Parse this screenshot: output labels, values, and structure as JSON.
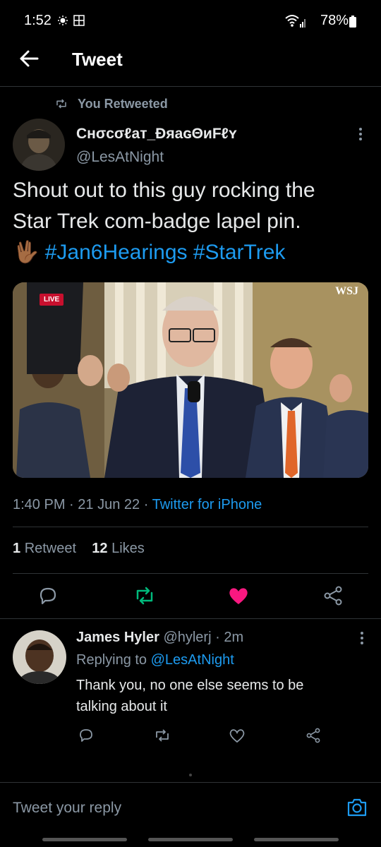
{
  "status_bar": {
    "time": "1:52",
    "battery": "78%"
  },
  "header": {
    "title": "Tweet"
  },
  "tweet": {
    "retweeted_label": "You Retweeted",
    "author_name": "Cʜσcσℓaт_ÐяaɢΘиFℓʏ",
    "author_handle": "@LesAtNight",
    "text_line1": "Shout out to this guy rocking the",
    "text_line2": "Star Trek com-badge lapel pin.",
    "emoji": "🖖🏾",
    "hashtag1": "#Jan6Hearings",
    "hashtag2": "#StarTrek",
    "media": {
      "live_badge": "LIVE",
      "logo": "WSJ"
    },
    "time": "1:40 PM",
    "date": "21 Jun 22",
    "separator": "·",
    "source": "Twitter for iPhone",
    "retweet_count": "1",
    "retweet_label": "Retweet",
    "like_count": "12",
    "like_label": "Likes"
  },
  "reply": {
    "name": "James Hyler",
    "handle": "@hylerj",
    "separator": "·",
    "age": "2m",
    "replying_prefix": "Replying to",
    "replying_to": "@LesAtNight",
    "text_line1": "Thank you, no one else seems to be",
    "text_line2": "talking about it"
  },
  "composer": {
    "placeholder": "Tweet your reply"
  },
  "colors": {
    "accent": "#1d9bf0",
    "retweet": "#00ba7c",
    "like": "#f91880",
    "background": "#000000"
  },
  "icons": [
    "arrow-left-icon",
    "retweet-icon",
    "more-vertical-icon",
    "reply-icon",
    "heart-icon",
    "share-icon",
    "camera-icon"
  ]
}
